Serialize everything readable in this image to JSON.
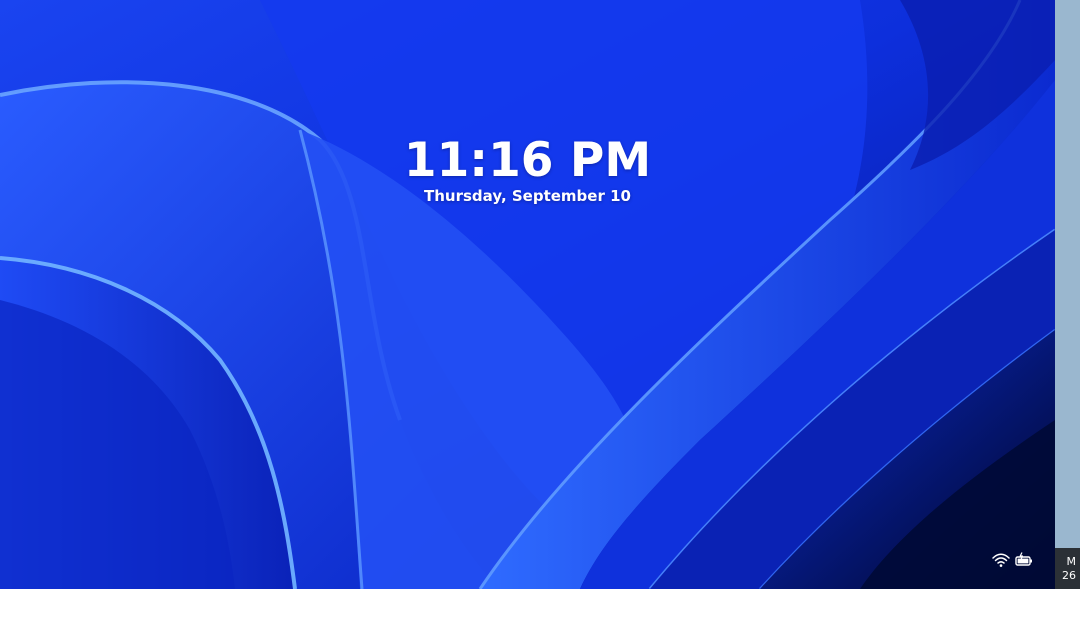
{
  "lock_screen": {
    "time": "11:16 PM",
    "date": "Thursday, September 10",
    "status_icons": [
      "wifi-icon",
      "battery-charging-icon"
    ]
  },
  "taskbar_fragment": {
    "time_partial": "M",
    "date_partial": "26"
  },
  "colors": {
    "wallpaper_base": "#0f34d8",
    "wallpaper_highlight": "#4f8dff",
    "wallpaper_dark": "#00104a",
    "right_edge_panel": "#9ab7cf",
    "taskbar": "#2b3036",
    "text": "#ffffff"
  }
}
